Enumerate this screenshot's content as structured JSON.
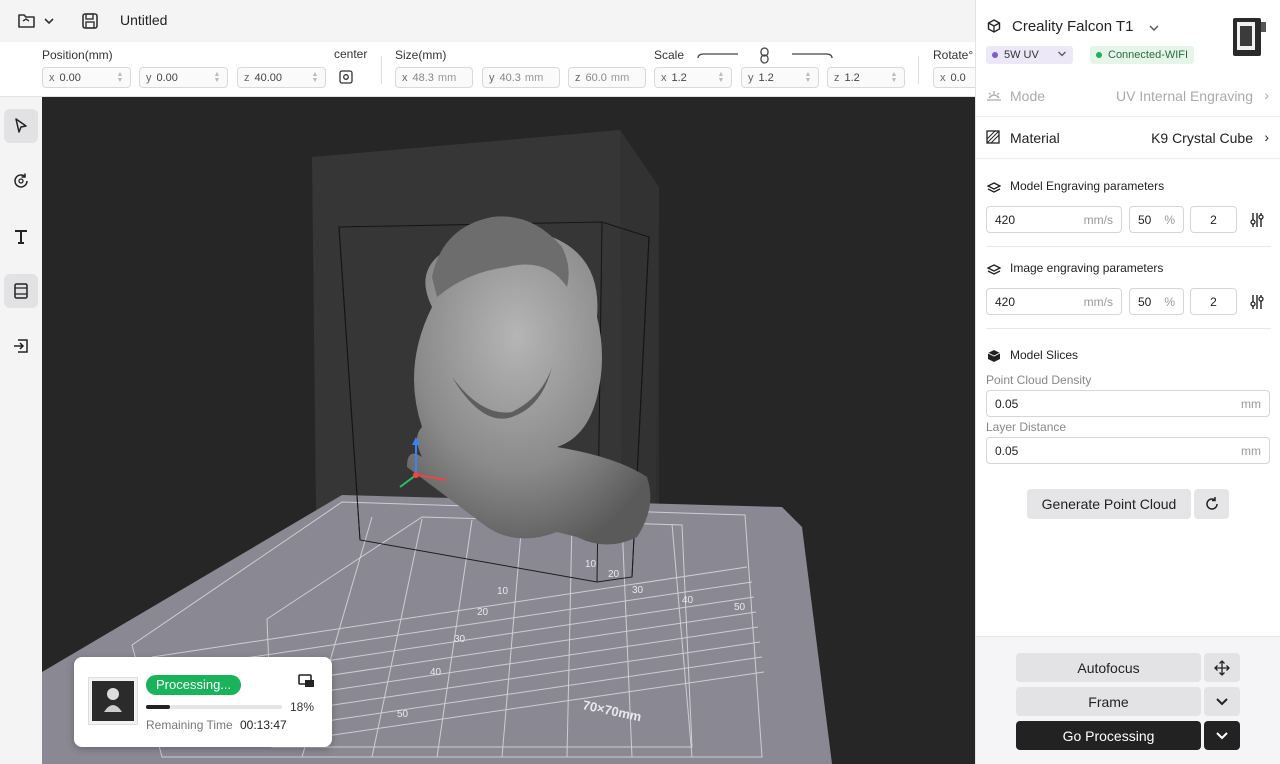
{
  "topbar": {
    "file_title": "Untitled",
    "icons": [
      "folder-open-icon",
      "chevron-down-icon",
      "save-icon"
    ]
  },
  "transform": {
    "position_label": "Position(mm)",
    "center_label": "center",
    "size_label": "Size(mm)",
    "scale_label": "Scale",
    "rotate_label": "Rotate°",
    "position": {
      "x": "0.00",
      "y": "0.00",
      "z": "40.00"
    },
    "size": {
      "x": "48.3",
      "y": "40.3",
      "z": "60.0",
      "unit": "mm"
    },
    "scale": {
      "x": "1.2",
      "y": "1.2",
      "z": "1.2"
    },
    "rotate": {
      "x": "0.0"
    },
    "axes": {
      "x": "x",
      "y": "y",
      "z": "z"
    }
  },
  "left_tools": [
    "select-icon",
    "rotate-icon",
    "text-tool-icon",
    "material-icon",
    "exit-icon"
  ],
  "viewport": {
    "grid_labels": [
      "10",
      "20",
      "30",
      "40",
      "50",
      "10",
      "20",
      "30",
      "40",
      "50"
    ],
    "size_label": "70×70mm",
    "colors": {
      "background": "#262626",
      "plate": "#8a8993",
      "grid": "#d9d9de",
      "bust": "#8e8e8e"
    }
  },
  "processing": {
    "status": "Processing...",
    "progress_percent": 18,
    "progress_text": "18%",
    "remaining_label": "Remaining Time",
    "remaining_time": "00:13:47",
    "accent": "#19b35a"
  },
  "panel": {
    "device_name": "Creality Falcon T1",
    "laser_chip": "5W UV",
    "connection_chip": "Connected-WIFI",
    "mode_label": "Mode",
    "mode_value": "UV Internal Engraving",
    "material_label": "Material",
    "material_value": "K9 Crystal Cube",
    "model_params": {
      "title": "Model Engraving parameters",
      "speed": "420",
      "speed_unit": "mm/s",
      "power": "50",
      "power_unit": "%",
      "passes": "2"
    },
    "image_params": {
      "title": "Image engraving parameters",
      "speed": "420",
      "speed_unit": "mm/s",
      "power": "50",
      "power_unit": "%",
      "passes": "2"
    },
    "slices": {
      "title": "Model Slices",
      "density_label": "Point Cloud Density",
      "density_value": "0.05",
      "density_unit": "mm",
      "layer_label": "Layer Distance",
      "layer_value": "0.05",
      "layer_unit": "mm"
    },
    "generate_label": "Generate Point Cloud",
    "actions": {
      "autofocus": "Autofocus",
      "frame": "Frame",
      "go": "Go Processing"
    }
  }
}
